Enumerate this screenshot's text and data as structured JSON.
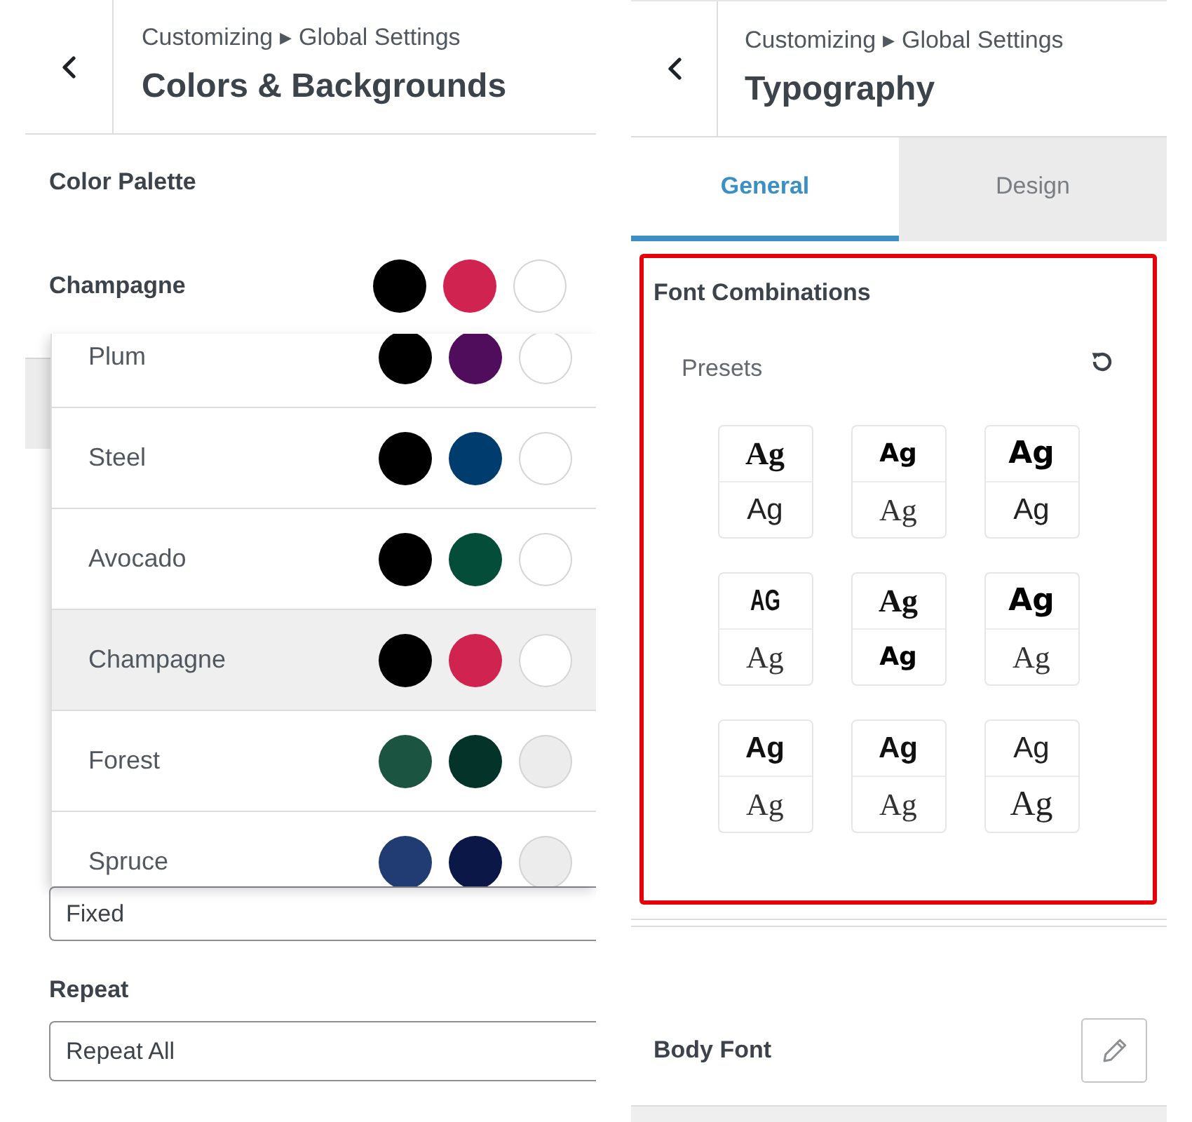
{
  "colors_panel": {
    "breadcrumb": "Customizing ▸ Global Settings",
    "title": "Colors & Backgrounds",
    "color_palette": {
      "label": "Color Palette",
      "current": {
        "name": "Champagne",
        "swatches": [
          {
            "color": "#000000"
          },
          {
            "color": "#d0234f"
          },
          {
            "color": "#ffffff"
          }
        ]
      },
      "dropdown": {
        "expanded": true,
        "options": [
          {
            "name": "Plum",
            "selected": false,
            "swatches": [
              {
                "color": "#000000"
              },
              {
                "color": "#4f0d5c"
              },
              {
                "color": "#ffffff"
              }
            ]
          },
          {
            "name": "Steel",
            "selected": false,
            "swatches": [
              {
                "color": "#000000"
              },
              {
                "color": "#003c6e"
              },
              {
                "color": "#ffffff"
              }
            ]
          },
          {
            "name": "Avocado",
            "selected": false,
            "swatches": [
              {
                "color": "#000000"
              },
              {
                "color": "#044d38"
              },
              {
                "color": "#ffffff"
              }
            ]
          },
          {
            "name": "Champagne",
            "selected": true,
            "swatches": [
              {
                "color": "#000000"
              },
              {
                "color": "#d0234f"
              },
              {
                "color": "#ffffff"
              }
            ]
          },
          {
            "name": "Forest",
            "selected": false,
            "swatches": [
              {
                "color": "#1b5541"
              },
              {
                "color": "#043429"
              },
              {
                "color": "#ececec"
              }
            ]
          },
          {
            "name": "Spruce",
            "selected": false,
            "swatches": [
              {
                "color": "#213b73"
              },
              {
                "color": "#0b1746"
              },
              {
                "color": "#ececec"
              }
            ]
          }
        ]
      }
    },
    "attachment": {
      "value": "Fixed"
    },
    "repeat": {
      "label": "Repeat",
      "value": "Repeat All"
    }
  },
  "typography_panel": {
    "breadcrumb": "Customizing ▸ Global Settings",
    "title": "Typography",
    "tabs": [
      {
        "label": "General",
        "selected": true
      },
      {
        "label": "Design",
        "selected": false
      }
    ],
    "font_combinations": {
      "label": "Font Combinations",
      "highlighted": true,
      "presets_label": "Presets",
      "presets": [
        {
          "heading": {
            "text": "Ag",
            "kind": "serif-bold"
          },
          "body": {
            "text": "Ag",
            "kind": "sans"
          }
        },
        {
          "heading": {
            "text": "Ag",
            "kind": "sans-heavy"
          },
          "body": {
            "text": "Ag",
            "kind": "serif"
          }
        },
        {
          "heading": {
            "text": "Ag",
            "kind": "sans-black"
          },
          "body": {
            "text": "Ag",
            "kind": "sans"
          }
        },
        {
          "heading": {
            "text": "AG",
            "kind": "condensed"
          },
          "body": {
            "text": "Ag",
            "kind": "serif"
          }
        },
        {
          "heading": {
            "text": "Ag",
            "kind": "serif-bold"
          },
          "body": {
            "text": "Ag",
            "kind": "sans-heavy"
          }
        },
        {
          "heading": {
            "text": "Ag",
            "kind": "sans-black"
          },
          "body": {
            "text": "Ag",
            "kind": "serif"
          }
        },
        {
          "heading": {
            "text": "Ag",
            "kind": "sans-bold"
          },
          "body": {
            "text": "Ag",
            "kind": "serif"
          }
        },
        {
          "heading": {
            "text": "Ag",
            "kind": "sans-bold"
          },
          "body": {
            "text": "Ag",
            "kind": "serif"
          }
        },
        {
          "heading": {
            "text": "Ag",
            "kind": "sans"
          },
          "body": {
            "text": "Ag",
            "kind": "serif-large"
          }
        }
      ]
    },
    "body_font": {
      "label": "Body Font"
    }
  }
}
